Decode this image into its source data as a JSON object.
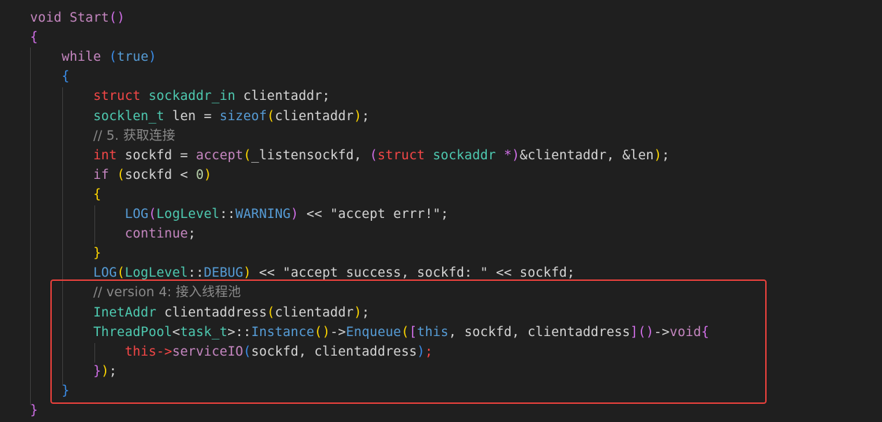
{
  "colors": {
    "background": "#1f1f1f",
    "highlight_box": "#e8413c"
  },
  "code": {
    "lines": [
      [
        {
          "t": "void",
          "c": "#c586c0"
        },
        {
          "t": " "
        },
        {
          "t": "Start",
          "c": "#c586c0"
        },
        {
          "t": "()",
          "c": "#d16fe8"
        }
      ],
      [
        {
          "t": "{",
          "c": "#d16fe8"
        }
      ],
      [
        {
          "t": "    "
        },
        {
          "t": "while",
          "c": "#c586c0"
        },
        {
          "t": " "
        },
        {
          "t": "(",
          "c": "#3b8eea"
        },
        {
          "t": "true",
          "c": "#569cd6"
        },
        {
          "t": ")",
          "c": "#3b8eea"
        }
      ],
      [
        {
          "t": "    "
        },
        {
          "t": "{",
          "c": "#3b8eea"
        }
      ],
      [
        {
          "t": "        "
        },
        {
          "t": "struct",
          "c": "#f44747"
        },
        {
          "t": " "
        },
        {
          "t": "sockaddr_in",
          "c": "#4ec9b0"
        },
        {
          "t": " clientaddr;",
          "c": "#d4d4d4"
        }
      ],
      [
        {
          "t": "        "
        },
        {
          "t": "socklen_t",
          "c": "#4ec9b0"
        },
        {
          "t": " len = ",
          "c": "#d4d4d4"
        },
        {
          "t": "sizeof",
          "c": "#569cd6"
        },
        {
          "t": "(",
          "c": "#ffd700"
        },
        {
          "t": "clientaddr",
          "c": "#d4d4d4"
        },
        {
          "t": ")",
          "c": "#ffd700"
        },
        {
          "t": ";",
          "c": "#d4d4d4"
        }
      ],
      [
        {
          "t": "        "
        },
        {
          "t": "// 5. 获取连接",
          "c": "#8a8a8a"
        }
      ],
      [
        {
          "t": "        "
        },
        {
          "t": "int",
          "c": "#f44747"
        },
        {
          "t": " sockfd = ",
          "c": "#d4d4d4"
        },
        {
          "t": "accept",
          "c": "#c586c0"
        },
        {
          "t": "(",
          "c": "#ffd700"
        },
        {
          "t": "_listensockfd, ",
          "c": "#d4d4d4"
        },
        {
          "t": "(",
          "c": "#d16fe8"
        },
        {
          "t": "struct",
          "c": "#f44747"
        },
        {
          "t": " "
        },
        {
          "t": "sockaddr",
          "c": "#4ec9b0"
        },
        {
          "t": " *",
          "c": "#d16fe8"
        },
        {
          "t": ")",
          "c": "#d16fe8"
        },
        {
          "t": "&clientaddr, &len",
          "c": "#d4d4d4"
        },
        {
          "t": ")",
          "c": "#ffd700"
        },
        {
          "t": ";",
          "c": "#d4d4d4"
        }
      ],
      [
        {
          "t": "        "
        },
        {
          "t": "if",
          "c": "#c586c0"
        },
        {
          "t": " "
        },
        {
          "t": "(",
          "c": "#ffd700"
        },
        {
          "t": "sockfd < ",
          "c": "#d4d4d4"
        },
        {
          "t": "0",
          "c": "#b5cea8"
        },
        {
          "t": ")",
          "c": "#ffd700"
        }
      ],
      [
        {
          "t": "        "
        },
        {
          "t": "{",
          "c": "#ffd700"
        }
      ],
      [
        {
          "t": "            "
        },
        {
          "t": "LOG",
          "c": "#569cd6"
        },
        {
          "t": "(",
          "c": "#d16fe8"
        },
        {
          "t": "LogLevel",
          "c": "#4ec9b0"
        },
        {
          "t": "::",
          "c": "#d4d4d4"
        },
        {
          "t": "WARNING",
          "c": "#569cd6"
        },
        {
          "t": ")",
          "c": "#d16fe8"
        },
        {
          "t": " << ",
          "c": "#d4d4d4"
        },
        {
          "t": "\"accept errr!\"",
          "c": "#d4d4d4"
        },
        {
          "t": ";",
          "c": "#d4d4d4"
        }
      ],
      [
        {
          "t": "            "
        },
        {
          "t": "continue",
          "c": "#c586c0"
        },
        {
          "t": ";",
          "c": "#d4d4d4"
        }
      ],
      [
        {
          "t": "        "
        },
        {
          "t": "}",
          "c": "#ffd700"
        }
      ],
      [
        {
          "t": "        "
        },
        {
          "t": "LOG",
          "c": "#569cd6"
        },
        {
          "t": "(",
          "c": "#ffd700"
        },
        {
          "t": "LogLevel",
          "c": "#4ec9b0"
        },
        {
          "t": "::",
          "c": "#d4d4d4"
        },
        {
          "t": "DEBUG",
          "c": "#569cd6"
        },
        {
          "t": ")",
          "c": "#ffd700"
        },
        {
          "t": " << ",
          "c": "#d4d4d4"
        },
        {
          "t": "\"accept success, sockfd: \"",
          "c": "#d4d4d4"
        },
        {
          "t": " << sockfd;",
          "c": "#d4d4d4"
        }
      ],
      [
        {
          "t": "        "
        },
        {
          "t": "// version 4: 接入线程池",
          "c": "#8a8a8a"
        }
      ],
      [
        {
          "t": "        "
        },
        {
          "t": "InetAddr",
          "c": "#4ec9b0"
        },
        {
          "t": " "
        },
        {
          "t": "clientaddress",
          "c": "#d4d4d4"
        },
        {
          "t": "(",
          "c": "#ffd700"
        },
        {
          "t": "clientaddr",
          "c": "#d4d4d4"
        },
        {
          "t": ")",
          "c": "#ffd700"
        },
        {
          "t": ";",
          "c": "#d4d4d4"
        }
      ],
      [
        {
          "t": "        "
        },
        {
          "t": "ThreadPool",
          "c": "#4ec9b0"
        },
        {
          "t": "<",
          "c": "#d4d4d4"
        },
        {
          "t": "task_t",
          "c": "#4ec9b0"
        },
        {
          "t": ">::",
          "c": "#d4d4d4"
        },
        {
          "t": "Instance",
          "c": "#569cd6"
        },
        {
          "t": "()",
          "c": "#ffd700"
        },
        {
          "t": "->",
          "c": "#d4d4d4"
        },
        {
          "t": "Enqueue",
          "c": "#569cd6"
        },
        {
          "t": "(",
          "c": "#ffd700"
        },
        {
          "t": "[",
          "c": "#d16fe8"
        },
        {
          "t": "this",
          "c": "#569cd6"
        },
        {
          "t": ", sockfd, clientaddress",
          "c": "#d4d4d4"
        },
        {
          "t": "]",
          "c": "#d16fe8"
        },
        {
          "t": "()",
          "c": "#d16fe8"
        },
        {
          "t": "->",
          "c": "#d4d4d4"
        },
        {
          "t": "void",
          "c": "#c586c0"
        },
        {
          "t": "{",
          "c": "#d16fe8"
        }
      ],
      [
        {
          "t": "            "
        },
        {
          "t": "this",
          "c": "#f44747"
        },
        {
          "t": "->",
          "c": "#f44747"
        },
        {
          "t": "serviceIO",
          "c": "#c586c0"
        },
        {
          "t": "(",
          "c": "#3b8eea"
        },
        {
          "t": "sockfd, clientaddress",
          "c": "#d4d4d4"
        },
        {
          "t": ")",
          "c": "#3b8eea"
        },
        {
          "t": ";",
          "c": "#f44747"
        }
      ],
      [
        {
          "t": "        "
        },
        {
          "t": "}",
          "c": "#d16fe8"
        },
        {
          "t": ")",
          "c": "#ffd700"
        },
        {
          "t": ";",
          "c": "#d4d4d4"
        }
      ],
      [
        {
          "t": "    "
        },
        {
          "t": "}",
          "c": "#3b8eea"
        }
      ],
      [
        {
          "t": "}",
          "c": "#d16fe8"
        }
      ]
    ]
  }
}
